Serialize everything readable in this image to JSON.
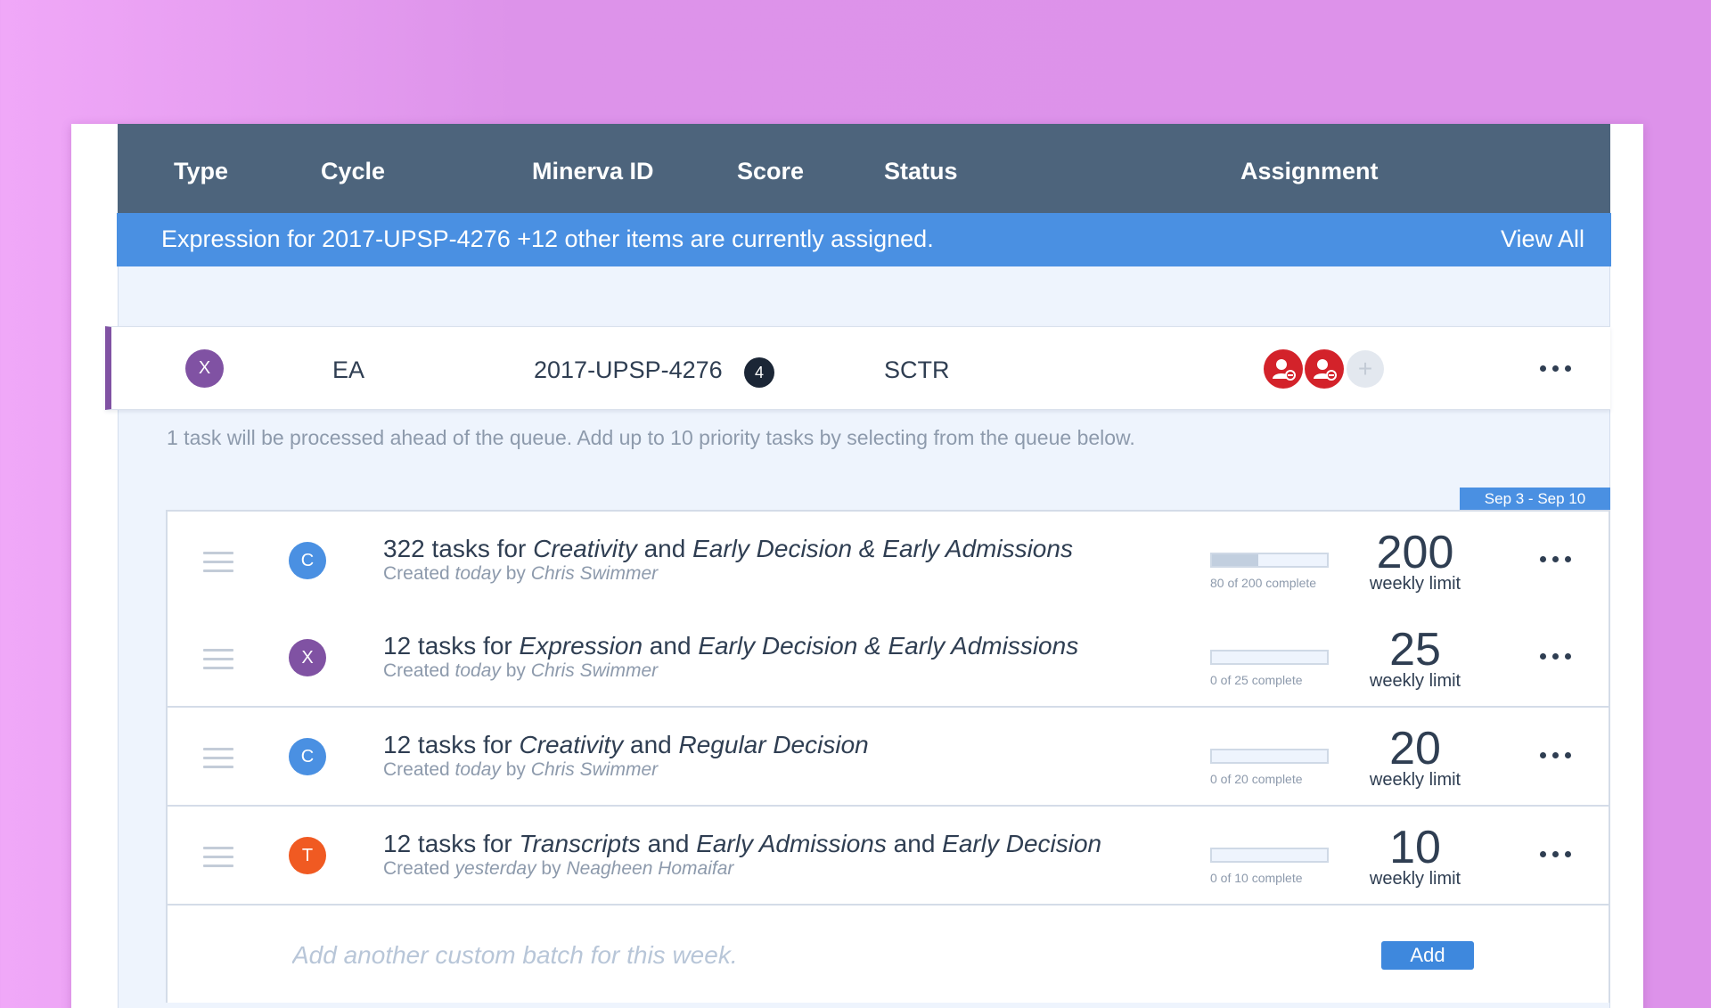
{
  "header": {
    "columns": [
      "Type",
      "Cycle",
      "Minerva ID",
      "Score",
      "Status",
      "Assignment"
    ]
  },
  "alert": {
    "message": "Expression for 2017-UPSP-4276 +12 other items are currently assigned.",
    "link": "View All"
  },
  "main_row": {
    "type_letter": "X",
    "type_color": "#8052a3",
    "cycle": "EA",
    "minerva_id": "2017-UPSP-4276",
    "score": "4",
    "status": "SCTR",
    "add_icon": "+"
  },
  "info_text": "1 task will be processed ahead of the queue.  Add up to 10 priority tasks by selecting from the queue below.",
  "date_range": "Sep 3 - Sep 10",
  "batches": [
    {
      "count_prefix": "322 tasks for ",
      "type": "Creativity",
      "joiner1": " and ",
      "decision1": "Early Decision & Early Admissions",
      "joiner2": "",
      "decision2": "",
      "created_prefix": "Created ",
      "created_when": "today",
      "created_by_prefix": " by ",
      "created_by": "Chris Swimmer",
      "letter": "C",
      "color": "#4a90e2",
      "progress_fraction": 0.4,
      "progress_label": "80 of 200 complete",
      "limit": "200",
      "limit_label": "weekly limit"
    },
    {
      "count_prefix": "12 tasks for ",
      "type": "Expression",
      "joiner1": " and ",
      "decision1": "Early Decision & Early Admissions",
      "joiner2": "",
      "decision2": "",
      "created_prefix": "Created ",
      "created_when": "today",
      "created_by_prefix": " by ",
      "created_by": "Chris Swimmer",
      "letter": "X",
      "color": "#8052a3",
      "progress_fraction": 0,
      "progress_label": "0 of 25 complete",
      "limit": "25",
      "limit_label": "weekly limit"
    },
    {
      "count_prefix": "12 tasks for ",
      "type": "Creativity",
      "joiner1": " and ",
      "decision1": "Regular Decision",
      "joiner2": "",
      "decision2": "",
      "created_prefix": "Created ",
      "created_when": "today",
      "created_by_prefix": " by ",
      "created_by": "Chris Swimmer",
      "letter": "C",
      "color": "#4a90e2",
      "progress_fraction": 0,
      "progress_label": "0 of 20 complete",
      "limit": "20",
      "limit_label": "weekly limit"
    },
    {
      "count_prefix": "12 tasks for ",
      "type": "Transcripts",
      "joiner1": " and ",
      "decision1": "Early Admissions",
      "joiner2": " and ",
      "decision2": "Early Decision",
      "created_prefix": "Created ",
      "created_when": "yesterday",
      "created_by_prefix": " by ",
      "created_by": "Neagheen Homaifar",
      "letter": "T",
      "color": "#f05a22",
      "progress_fraction": 0,
      "progress_label": "0 of 10 complete",
      "limit": "10",
      "limit_label": "weekly limit"
    }
  ],
  "add_batch": {
    "placeholder": "Add another custom batch for this week.",
    "button": "Add"
  },
  "icons": {
    "avatar": "user-remove-icon",
    "more": "more-horizontal-icon",
    "drag": "drag-handle-icon"
  }
}
